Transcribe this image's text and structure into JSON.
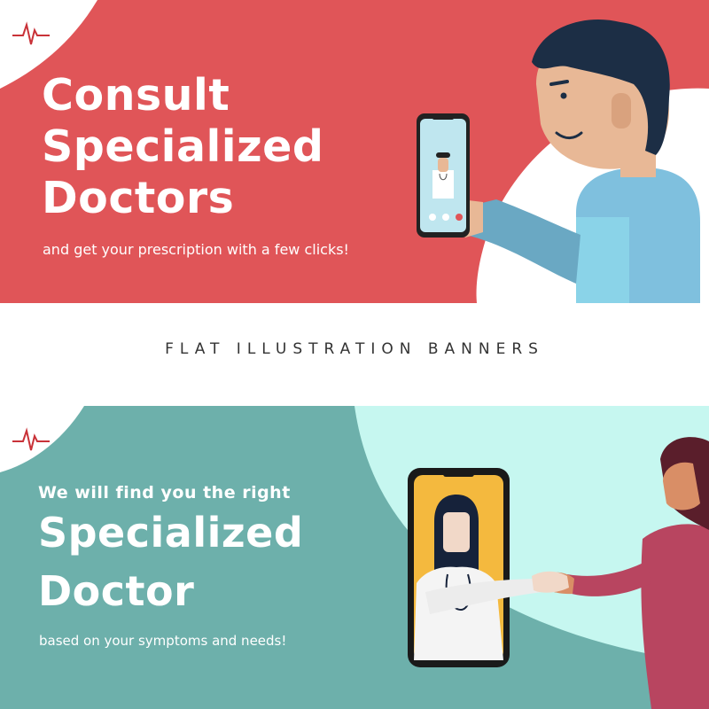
{
  "banner_1": {
    "headline": [
      "Consult",
      "Specialized",
      "Doctors"
    ],
    "subline": "and get your prescription with a few clicks!",
    "colors": {
      "background": "#e05558",
      "accent": "#ffffff"
    }
  },
  "divider": {
    "title": "FLAT ILLUSTRATION BANNERS"
  },
  "banner_2": {
    "pre_headline": "We will find you the right",
    "headline": [
      "Specialized",
      "Doctor"
    ],
    "subline": "based on your symptoms and needs!",
    "colors": {
      "background": "#6db0ab",
      "accent": "#c6f7f0"
    }
  },
  "icons": [
    "heartbeat-pulse-icon",
    "doctor-avatar-icon",
    "microphone-icon",
    "camera-icon",
    "hang-up-icon",
    "stethoscope-icon"
  ]
}
